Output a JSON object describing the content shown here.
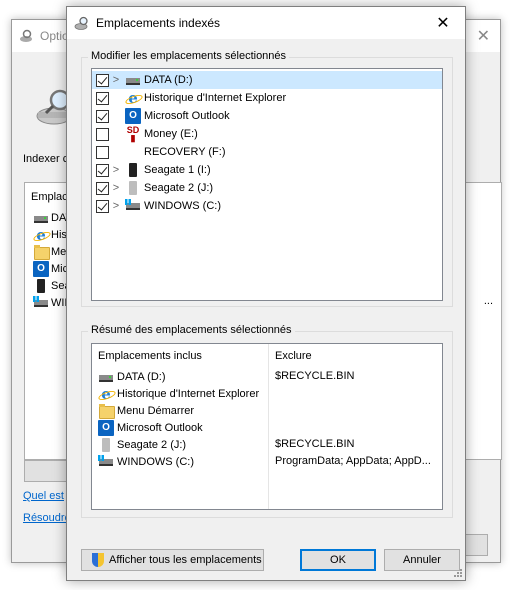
{
  "background_window": {
    "title": "Optio",
    "index_label": "Indexer c",
    "list_header": "Emplace",
    "list_items": [
      {
        "label": "DAT",
        "icon": "drive-icon"
      },
      {
        "label": "Histo",
        "icon": "ie-icon"
      },
      {
        "label": "Menu",
        "icon": "folder-icon"
      },
      {
        "label": "Micro",
        "icon": "outlook-icon"
      },
      {
        "label": "Seag",
        "icon": "external-drive-icon"
      },
      {
        "label": "WIN",
        "icon": "windows-drive-icon"
      }
    ],
    "ellipsis": "...",
    "modify_button": "M",
    "link1": "Quel est",
    "link2": "Résoudre"
  },
  "dialog": {
    "title": "Emplacements indexés",
    "close_glyph": "✕",
    "group1_label": "Modifier les emplacements sélectionnés",
    "tree": [
      {
        "label": "DATA (D:)",
        "checked": true,
        "expandable": true,
        "icon": "drive-icon",
        "selected": true
      },
      {
        "label": "Historique d'Internet Explorer",
        "checked": true,
        "expandable": false,
        "icon": "ie-icon",
        "selected": false
      },
      {
        "label": "Microsoft Outlook",
        "checked": true,
        "expandable": false,
        "icon": "outlook-icon",
        "selected": false
      },
      {
        "label": "Money (E:)",
        "checked": false,
        "expandable": false,
        "icon": "sd-card-icon",
        "selected": false
      },
      {
        "label": "RECOVERY (F:)",
        "checked": false,
        "expandable": false,
        "icon": "drive-icon",
        "selected": false
      },
      {
        "label": "Seagate 1 (I:)",
        "checked": true,
        "expandable": true,
        "icon": "external-drive-icon",
        "selected": false
      },
      {
        "label": "Seagate 2 (J:)",
        "checked": true,
        "expandable": true,
        "icon": "external-drive-light-icon",
        "selected": false
      },
      {
        "label": "WINDOWS (C:)",
        "checked": true,
        "expandable": true,
        "icon": "windows-drive-icon",
        "selected": false
      }
    ],
    "group2_label": "Résumé des emplacements sélectionnés",
    "summary": {
      "col_included": "Emplacements inclus",
      "col_exclude": "Exclure",
      "rows": [
        {
          "location": "DATA (D:)",
          "exclude": "$RECYCLE.BIN",
          "icon": "drive-icon"
        },
        {
          "location": "Historique d'Internet Explorer",
          "exclude": "",
          "icon": "ie-icon"
        },
        {
          "location": "Menu Démarrer",
          "exclude": "",
          "icon": "folder-icon"
        },
        {
          "location": "Microsoft Outlook",
          "exclude": "",
          "icon": "outlook-icon"
        },
        {
          "location": "Seagate 2 (J:)",
          "exclude": "$RECYCLE.BIN",
          "icon": "external-drive-light-icon"
        },
        {
          "location": "WINDOWS (C:)",
          "exclude": "ProgramData; AppData; AppD...",
          "icon": "windows-drive-icon"
        }
      ]
    },
    "buttons": {
      "show_all": "Afficher tous les emplacements",
      "ok": "OK",
      "cancel": "Annuler"
    }
  }
}
